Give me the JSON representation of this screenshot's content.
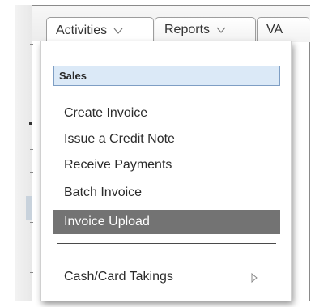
{
  "tabs": [
    {
      "label": "Activities",
      "icon": "chevron-down-icon"
    },
    {
      "label": "Reports",
      "icon": "chevron-down-icon"
    },
    {
      "label": "VA"
    }
  ],
  "menu": {
    "section_label": "Sales",
    "items": [
      {
        "label": "Create Invoice"
      },
      {
        "label": "Issue a Credit Note"
      },
      {
        "label": "Receive Payments"
      },
      {
        "label": "Batch Invoice"
      },
      {
        "label": "Invoice Upload",
        "highlighted": true
      }
    ],
    "after_separator": {
      "label": "Cash/Card Takings",
      "icon": "submenu-arrow-icon"
    }
  },
  "colors": {
    "section_bg": "#dbe9f7",
    "section_border": "#7e9ec4",
    "highlight_bg": "#737373"
  }
}
